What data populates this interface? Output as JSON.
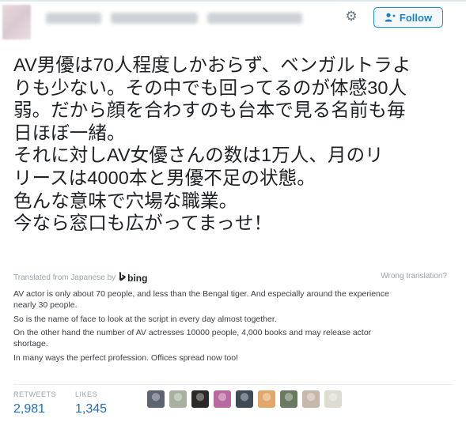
{
  "header": {
    "follow_label": "Follow"
  },
  "tweet": {
    "lines": [
      "AV男優は70人程度しかおらず、ベンガルトラよ",
      "りも少ない。その中でも回ってるのが体感30人",
      "弱。だから顔を合わすのも台本で見る名前も毎",
      "日ほぼ一緒。",
      "それに対しAV女優さんの数は1万人、月のリ",
      "リースは4000本と男優不足の状態。",
      "色んな意味で穴場な職業。",
      "今なら窓口も広がってまっせ！"
    ]
  },
  "translation_meta": {
    "translated_from": "Translated from Japanese by",
    "bing": "bing",
    "wrong_translation": "Wrong translation?"
  },
  "translation": {
    "lines": [
      "AV actor is only about 70 people, and less than the Bengal tiger. And especially around the experience",
      "nearly 30 people.",
      "So is the name of face to look at the script in every day almost together.",
      "On the other hand the number of AV actresses 10000 people, 4,000 books and may release actor",
      "shortage.",
      "In many ways the perfect profession. Offices spread now too!"
    ]
  },
  "stats": {
    "retweets_label": "RETWEETS",
    "retweets_value": "2,981",
    "likes_label": "LIKES",
    "likes_value": "1,345"
  },
  "likers": [
    {
      "name": "liker-avatar-1",
      "color": "#5b6470"
    },
    {
      "name": "liker-avatar-2",
      "color": "#a9b0a0"
    },
    {
      "name": "liker-avatar-3",
      "color": "#2c2a28"
    },
    {
      "name": "liker-avatar-4",
      "color": "#b86aa0"
    },
    {
      "name": "liker-avatar-5",
      "color": "#3f4a55"
    },
    {
      "name": "liker-avatar-6",
      "color": "#e2a86a"
    },
    {
      "name": "liker-avatar-7",
      "color": "#6a7a60"
    },
    {
      "name": "liker-avatar-8",
      "color": "#c8b8ac"
    },
    {
      "name": "liker-avatar-9",
      "color": "#dcdcd0"
    }
  ],
  "colors": {
    "accent": "#1d8dd9",
    "stat_value": "#1d6fbb"
  }
}
